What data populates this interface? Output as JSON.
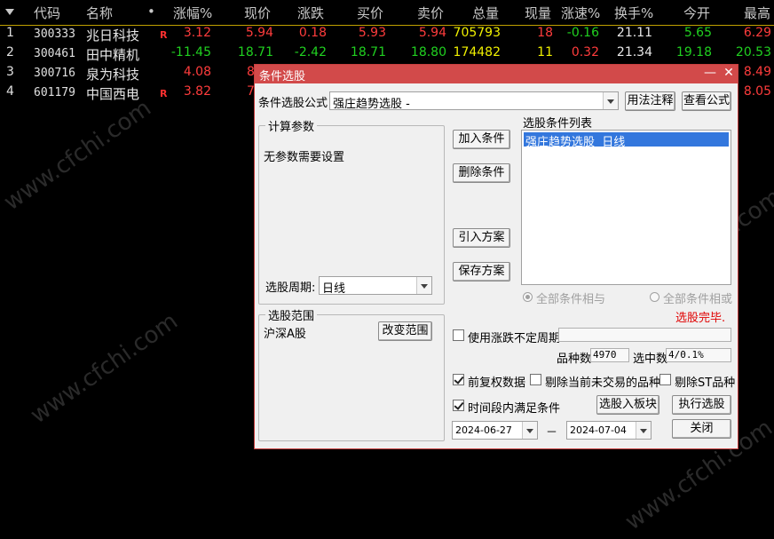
{
  "table": {
    "columns": [
      "代码",
      "名称",
      "•",
      "涨幅%",
      "现价",
      "涨跌",
      "买价",
      "卖价",
      "总量",
      "现量",
      "涨速%",
      "换手%",
      "今开",
      "最高"
    ],
    "rows": [
      {
        "idx": "1",
        "code": "300333",
        "name": "兆日科技",
        "mark": "R",
        "pct": "3.12",
        "price": "5.94",
        "chg": "0.18",
        "bid": "5.93",
        "ask": "5.94",
        "vol": "705793",
        "cur": "18",
        "speed": "-0.16",
        "turn": "21.11",
        "open": "5.65",
        "high": "6.29"
      },
      {
        "idx": "2",
        "code": "300461",
        "name": "田中精机",
        "mark": "",
        "pct": "-11.45",
        "price": "18.71",
        "chg": "-2.42",
        "bid": "18.71",
        "ask": "18.80",
        "vol": "174482",
        "cur": "11",
        "speed": "0.32",
        "turn": "21.34",
        "open": "19.18",
        "high": "20.53"
      },
      {
        "idx": "3",
        "code": "300716",
        "name": "泉为科技",
        "mark": "",
        "pct": "4.08",
        "price": "8",
        "chg": "",
        "bid": "",
        "ask": "",
        "vol": "",
        "cur": "",
        "speed": "",
        "turn": "",
        "open": "",
        "high": "8.49"
      },
      {
        "idx": "4",
        "code": "601179",
        "name": "中国西电",
        "mark": "R",
        "pct": "3.82",
        "price": "7",
        "chg": "",
        "bid": "",
        "ask": "",
        "vol": "",
        "cur": "",
        "speed": "",
        "turn": "",
        "open": "",
        "high": "8.05"
      }
    ]
  },
  "watermark": "www.cfchi.com",
  "dialog": {
    "title": "条件选股",
    "formula_label": "条件选股公式",
    "formula_value": "强庄趋势选股 -",
    "usage_button": "用法注释",
    "view_button": "查看公式",
    "params_group": "计算参数",
    "params_text": "无参数需要设置",
    "period_label": "选股周期:",
    "period_value": "日线",
    "range_group": "选股范围",
    "range_value": "沪深A股",
    "change_range_button": "改变范围",
    "add_button": "加入条件",
    "delete_button": "删除条件",
    "import_button": "引入方案",
    "save_button": "保存方案",
    "list_title": "选股条件列表",
    "list_item": "强庄趋势选股  日线",
    "radio_and": "全部条件相与",
    "radio_or": "全部条件相或",
    "status": "选股完毕.",
    "use_period_label": "使用涨跌不定周期",
    "count_label": "品种数",
    "count_value": "4970",
    "selected_label": "选中数",
    "selected_value": "4/0.1%",
    "prefq_label": "前复权数据",
    "exclude_notrade_label": "剔除当前未交易的品种",
    "exclude_st_label": "剔除ST品种",
    "time_label": "时间段内满足条件",
    "to_block_button": "选股入板块",
    "run_button": "执行选股",
    "date_from": "2024-06-27",
    "date_sep": "－",
    "date_to": "2024-07-04",
    "close_button": "关闭",
    "minimize": "—",
    "close_x": "✕"
  }
}
